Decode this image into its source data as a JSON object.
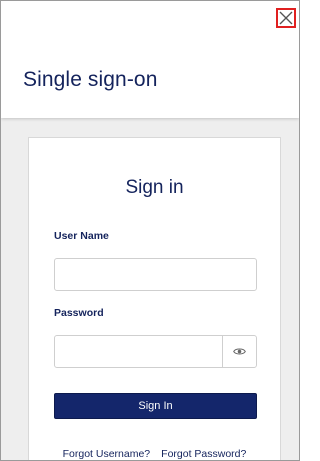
{
  "header": {
    "title": "Single sign-on",
    "close_icon": "close-icon"
  },
  "card": {
    "title": "Sign in",
    "username_label": "User Name",
    "username_value": "",
    "password_label": "Password",
    "password_value": "",
    "show_password_icon": "eye-icon",
    "signin_label": "Sign In",
    "forgot_username": "Forgot Username?",
    "forgot_password": "Forgot Password?"
  },
  "colors": {
    "primary": "#14235c",
    "button": "#14266b",
    "close_highlight": "#e02020",
    "background": "#eeeeee"
  }
}
